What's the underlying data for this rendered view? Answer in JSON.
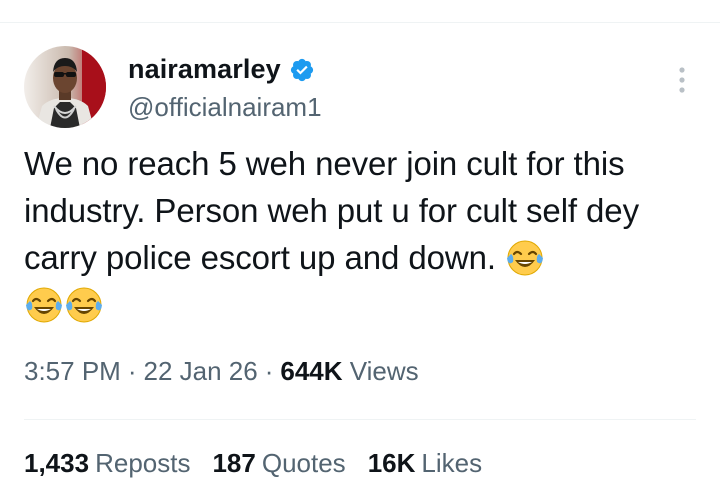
{
  "user": {
    "display_name": "nairamarley",
    "handle": "@officialnairam1",
    "verified": true
  },
  "icons": {
    "verified": "verified-badge-icon",
    "more": "more-vertical-icon",
    "emoji": "face-with-tears-of-joy-icon"
  },
  "colors": {
    "verified": "#1d9bf0",
    "secondary_text": "#536471",
    "primary_text": "#0f1419",
    "divider": "#eff3f4"
  },
  "tweet": {
    "text": "We no reach 5 weh never join cult for this industry. Person weh put u for cult self dey carry police escort up and down.",
    "emoji_count": 3
  },
  "meta": {
    "time": "3:57 PM",
    "separator": "·",
    "date": "22 Jan 26",
    "views_count": "644K",
    "views_label": "Views"
  },
  "stats": {
    "reposts_count": "1,433",
    "reposts_label": "Reposts",
    "quotes_count": "187",
    "quotes_label": "Quotes",
    "likes_count": "16K",
    "likes_label": "Likes"
  }
}
